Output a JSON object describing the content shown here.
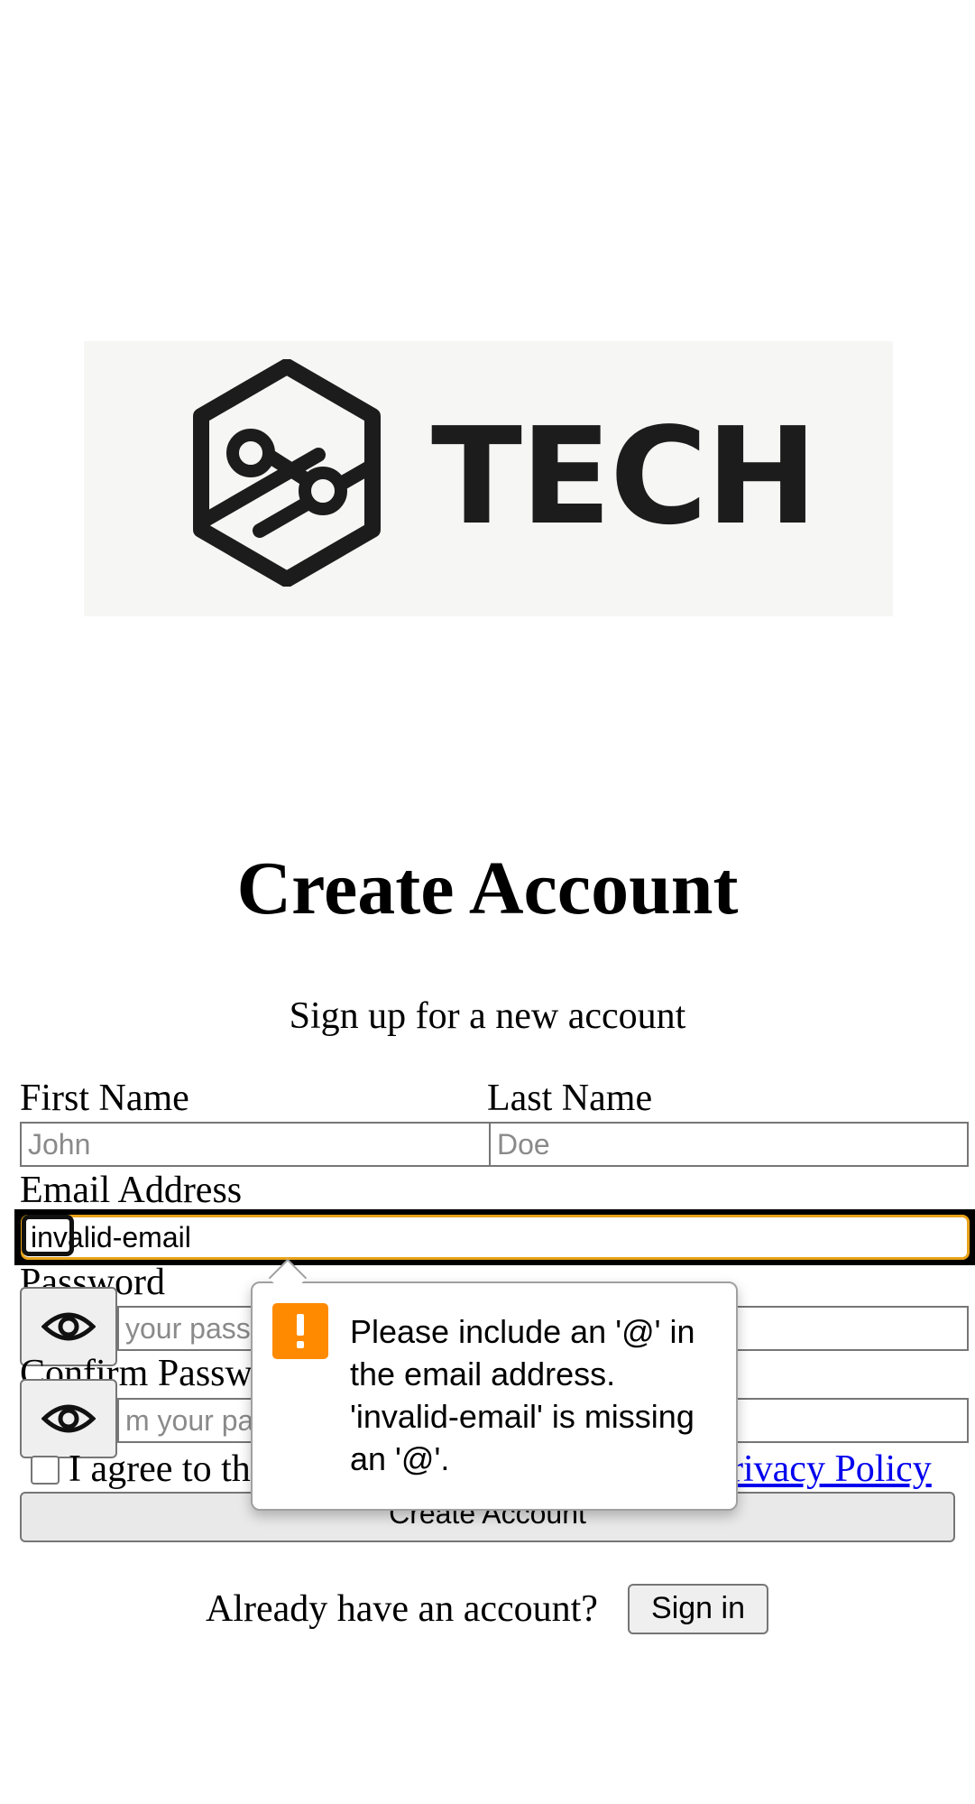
{
  "logo": {
    "text": "TECH",
    "icon": "hexagon-share-icon",
    "color": "#1c1c1c"
  },
  "header": {
    "title": "Create Account",
    "subtitle": "Sign up for a new account"
  },
  "form": {
    "first_name": {
      "label": "First Name",
      "placeholder": "John"
    },
    "last_name": {
      "label": "Last Name",
      "placeholder": "Doe"
    },
    "email": {
      "label": "Email Address",
      "value": "invalid-email",
      "icon": "mail-icon"
    },
    "password": {
      "label": "Password",
      "placeholder": "your pass",
      "toggle_icon": "eye-icon"
    },
    "confirm_password": {
      "label": "Confirm Passw",
      "placeholder": "m your pa",
      "toggle_icon": "eye-icon"
    },
    "terms": {
      "text_start": "I agree to th",
      "privacy_link": "rivacy Policy"
    },
    "submit_label": "Create Account"
  },
  "footer": {
    "prompt": "Already have an account?",
    "signin_label": "Sign in"
  },
  "validation_tooltip": {
    "icon": "warning-icon",
    "icon_color": "#ff8a00",
    "message": "Please include an '@' in the email address. 'invalid-email' is missing an '@'."
  },
  "colors": {
    "focus_ring": "#e8a317",
    "link": "#0000ee"
  }
}
